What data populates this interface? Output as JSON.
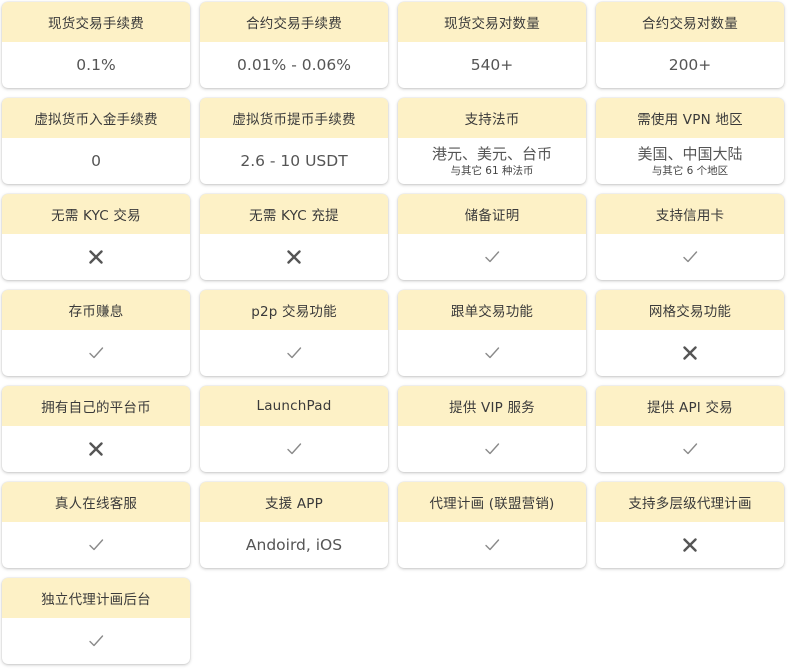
{
  "cards": [
    {
      "label": "现货交易手续费",
      "value": "0.1%"
    },
    {
      "label": "合约交易手续费",
      "value": "0.01% - 0.06%"
    },
    {
      "label": "现货交易对数量",
      "value": "540+"
    },
    {
      "label": "合约交易对数量",
      "value": "200+"
    },
    {
      "label": "虚拟货币入金手续费",
      "value": "0"
    },
    {
      "label": "虚拟货币提币手续费",
      "value": "2.6 - 10 USDT"
    },
    {
      "label": "支持法币",
      "value": "港元、美元、台币",
      "sub": "与其它 61 种法币"
    },
    {
      "label": "需使用 VPN 地区",
      "value": "美国、中国大陆",
      "sub": "与其它 6 个地区"
    },
    {
      "label": "无需 KYC 交易",
      "icon": "cross-icon"
    },
    {
      "label": "无需 KYC 充提",
      "icon": "cross-icon"
    },
    {
      "label": "储备证明",
      "icon": "check-icon"
    },
    {
      "label": "支持信用卡",
      "icon": "check-icon"
    },
    {
      "label": "存币赚息",
      "icon": "check-icon"
    },
    {
      "label": "p2p 交易功能",
      "icon": "check-icon"
    },
    {
      "label": "跟单交易功能",
      "icon": "check-icon"
    },
    {
      "label": "网格交易功能",
      "icon": "cross-icon"
    },
    {
      "label": "拥有自己的平台币",
      "icon": "cross-icon"
    },
    {
      "label": "LaunchPad",
      "icon": "check-icon"
    },
    {
      "label": "提供 VIP 服务",
      "icon": "check-icon"
    },
    {
      "label": "提供 API 交易",
      "icon": "check-icon"
    },
    {
      "label": "真人在线客服",
      "icon": "check-icon"
    },
    {
      "label": "支援 APP",
      "value": "Andoird, iOS"
    },
    {
      "label": "代理计画 (联盟营销)",
      "icon": "check-icon"
    },
    {
      "label": "支持多层级代理计画",
      "icon": "cross-icon"
    },
    {
      "label": "独立代理计画后台",
      "icon": "check-icon"
    }
  ],
  "colors": {
    "header_bg": "#fdf1c6",
    "check": "#8a8a8a",
    "cross": "#555555"
  }
}
